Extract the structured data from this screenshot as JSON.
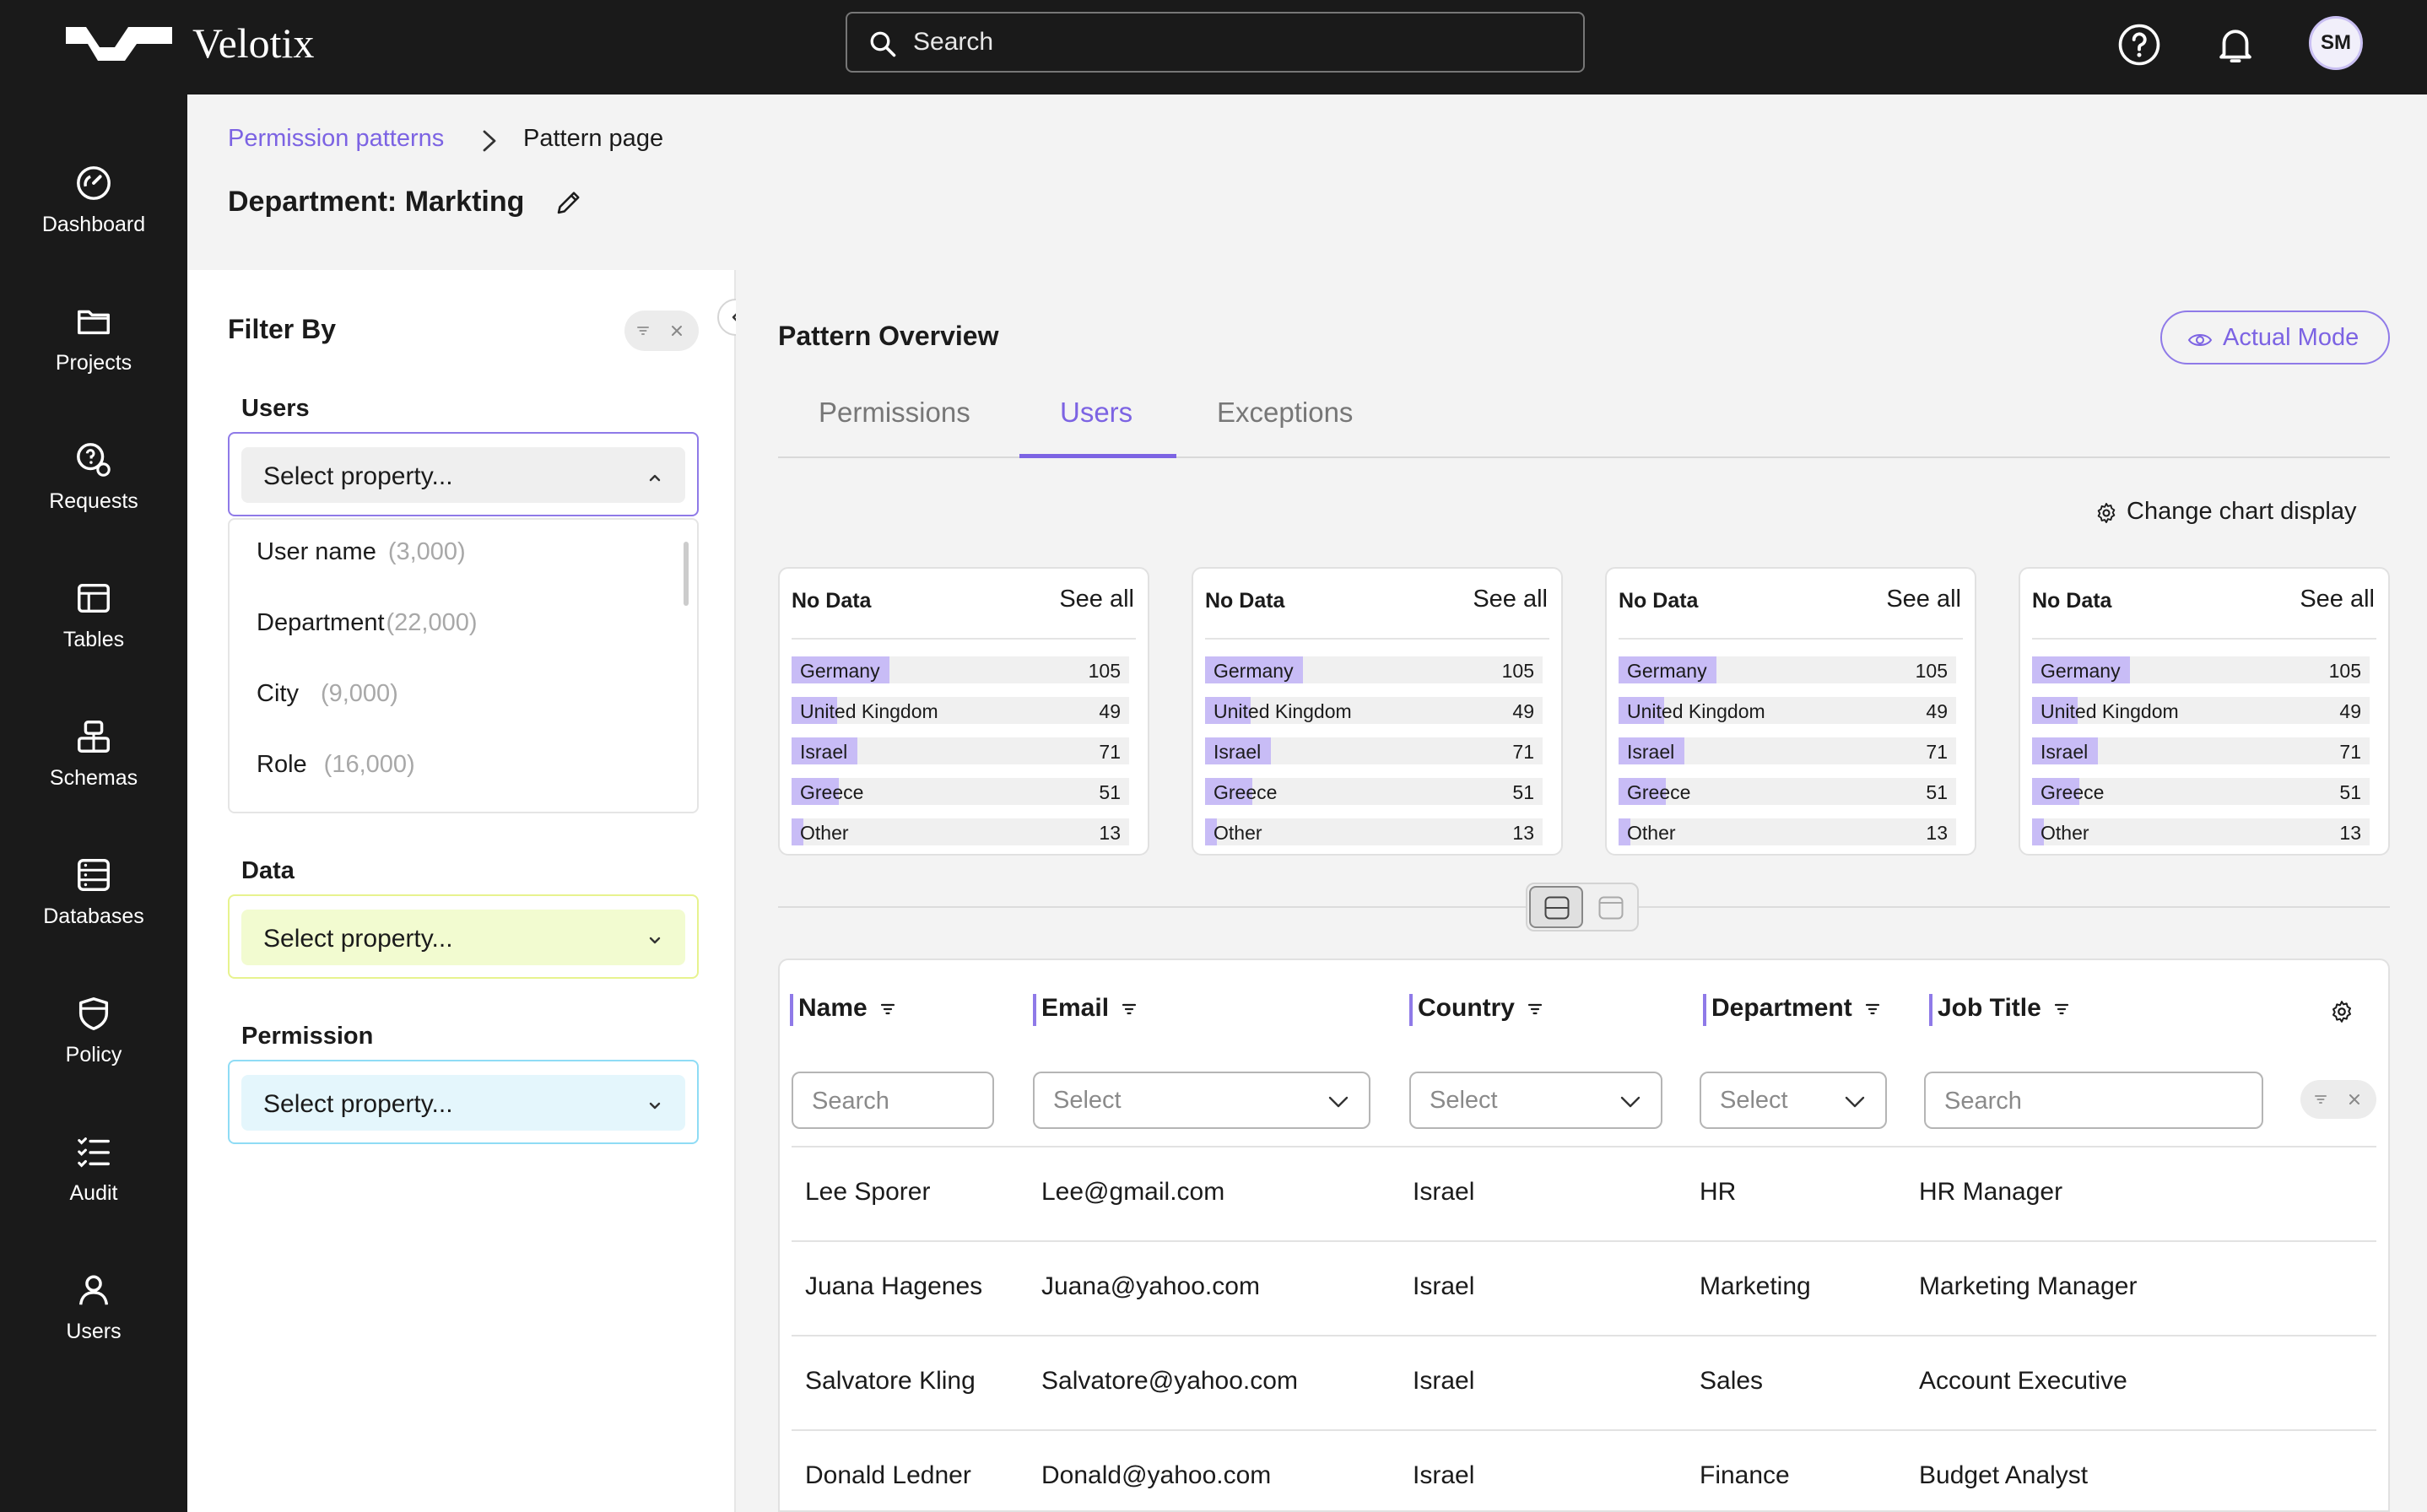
{
  "app": {
    "name": "Velotix",
    "search_placeholder": "Search",
    "avatar_initials": "SM",
    "colors": {
      "accent": "#7c63e3",
      "users": "#8f7ae8",
      "data": "#e1f56f",
      "permission": "#6bd2f2",
      "bar": "#c8bcf6"
    }
  },
  "sidebar": {
    "items": [
      {
        "label": "Dashboard",
        "icon": "dashboard-gauge-icon"
      },
      {
        "label": "Projects",
        "icon": "folder-icon"
      },
      {
        "label": "Requests",
        "icon": "request-icon"
      },
      {
        "label": "Tables",
        "icon": "table-icon"
      },
      {
        "label": "Schemas",
        "icon": "schema-icon"
      },
      {
        "label": "Databases",
        "icon": "database-icon"
      },
      {
        "label": "Policy",
        "icon": "shield-icon"
      },
      {
        "label": "Audit",
        "icon": "checklist-icon"
      },
      {
        "label": "Users",
        "icon": "user-icon"
      }
    ]
  },
  "breadcrumb": {
    "parent": "Permission patterns",
    "current": "Pattern page"
  },
  "page": {
    "title": "Department: Markting"
  },
  "filter": {
    "title": "Filter By",
    "users": {
      "label": "Users",
      "placeholder": "Select property...",
      "options": [
        {
          "name": "User name",
          "count": "(3,000)"
        },
        {
          "name": "Department",
          "count": "(22,000)"
        },
        {
          "name": "City",
          "count": "(9,000)"
        },
        {
          "name": "Role",
          "count": "(16,000)"
        }
      ]
    },
    "data": {
      "label": "Data",
      "placeholder": "Select property..."
    },
    "permission": {
      "label": "Permission",
      "placeholder": "Select property..."
    }
  },
  "overview": {
    "title": "Pattern Overview",
    "actual_mode": "Actual Mode",
    "tabs": [
      "Permissions",
      "Users",
      "Exceptions"
    ],
    "active_tab": "Users",
    "change_chart": "Change chart display"
  },
  "cards": [
    {
      "title": "No Data",
      "see_all": "See all",
      "rows": [
        {
          "label": "Germany",
          "value": 105
        },
        {
          "label": "United Kingdom",
          "value": 49
        },
        {
          "label": "Israel",
          "value": 71
        },
        {
          "label": "Greece",
          "value": 51
        },
        {
          "label": "Other",
          "value": 13
        }
      ]
    },
    {
      "title": "No Data",
      "see_all": "See all",
      "rows": [
        {
          "label": "Germany",
          "value": 105
        },
        {
          "label": "United Kingdom",
          "value": 49
        },
        {
          "label": "Israel",
          "value": 71
        },
        {
          "label": "Greece",
          "value": 51
        },
        {
          "label": "Other",
          "value": 13
        }
      ]
    },
    {
      "title": "No Data",
      "see_all": "See all",
      "rows": [
        {
          "label": "Germany",
          "value": 105
        },
        {
          "label": "United Kingdom",
          "value": 49
        },
        {
          "label": "Israel",
          "value": 71
        },
        {
          "label": "Greece",
          "value": 51
        },
        {
          "label": "Other",
          "value": 13
        }
      ]
    },
    {
      "title": "No Data",
      "see_all": "See all",
      "rows": [
        {
          "label": "Germany",
          "value": 105
        },
        {
          "label": "United Kingdom",
          "value": 49
        },
        {
          "label": "Israel",
          "value": 71
        },
        {
          "label": "Greece",
          "value": 51
        },
        {
          "label": "Other",
          "value": 13
        }
      ]
    }
  ],
  "table": {
    "columns": [
      "Name",
      "Email",
      "Country",
      "Department",
      "Job Title"
    ],
    "filters": {
      "name": "Search",
      "email": "Select",
      "country": "Select",
      "department": "Select",
      "job_title": "Search"
    },
    "rows": [
      [
        "Lee Sporer",
        "Lee@gmail.com",
        "Israel",
        "HR",
        "HR Manager"
      ],
      [
        "Juana Hagenes",
        "Juana@yahoo.com",
        "Israel",
        "Marketing",
        "Marketing Manager"
      ],
      [
        "Salvatore Kling",
        "Salvatore@yahoo.com",
        "Israel",
        "Sales",
        "Account Executive"
      ],
      [
        "Donald Ledner",
        "Donald@yahoo.com",
        "Israel",
        "Finance",
        "Budget Analyst"
      ]
    ]
  }
}
